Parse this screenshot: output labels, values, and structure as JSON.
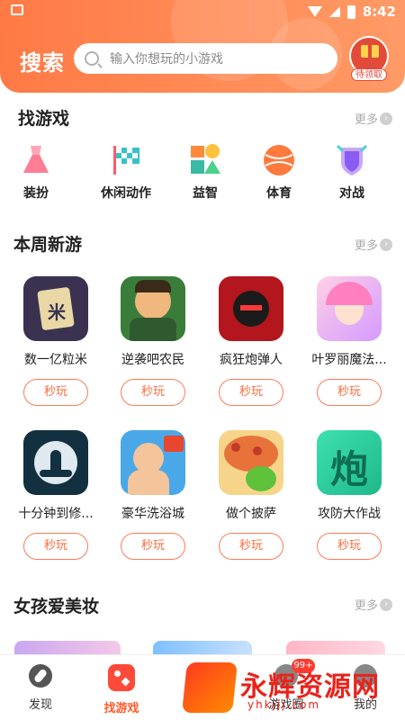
{
  "status_bar": {
    "time": "8:42"
  },
  "header": {
    "title": "搜索",
    "search_placeholder": "输入你想玩的小游戏",
    "avatar_badge": "待领取",
    "accent_color": "#ff7a45"
  },
  "categories_section": {
    "title": "找游戏",
    "more": "更多",
    "items": [
      {
        "label": "装扮",
        "icon": "dress-icon"
      },
      {
        "label": "休闲动作",
        "icon": "checkered-flag-icon"
      },
      {
        "label": "益智",
        "icon": "shapes-icon"
      },
      {
        "label": "体育",
        "icon": "ball-icon"
      },
      {
        "label": "对战",
        "icon": "shield-icon"
      }
    ]
  },
  "new_games_section": {
    "title": "本周新游",
    "more": "更多",
    "play_label": "秒玩",
    "games": [
      {
        "name": "数一亿粒米",
        "icon": "rice-icon"
      },
      {
        "name": "逆袭吧农民",
        "icon": "farmer-icon"
      },
      {
        "name": "疯狂炮弹人",
        "icon": "ninja-icon"
      },
      {
        "name": "叶罗丽魔法...",
        "icon": "fairy-icon"
      },
      {
        "name": "十分钟到修...",
        "icon": "meditation-icon"
      },
      {
        "name": "豪华洗浴城",
        "icon": "bath-icon"
      },
      {
        "name": "做个披萨",
        "icon": "pizza-icon"
      },
      {
        "name": "攻防大作战",
        "icon": "cannon-char-icon"
      }
    ],
    "cannon_char": "炮"
  },
  "beauty_section": {
    "title": "女孩爱美妆",
    "more": "更多"
  },
  "bottom_nav": {
    "items": [
      {
        "label": "发现",
        "icon": "compass-icon"
      },
      {
        "label": "找游戏",
        "icon": "game-icon"
      },
      {
        "label": "游戏圈",
        "icon": "circle-icon"
      },
      {
        "label": "我的",
        "icon": "user-icon"
      }
    ],
    "badge": "99+"
  },
  "watermark": {
    "text": "永辉资源网",
    "url": "yhkjjj.com"
  }
}
